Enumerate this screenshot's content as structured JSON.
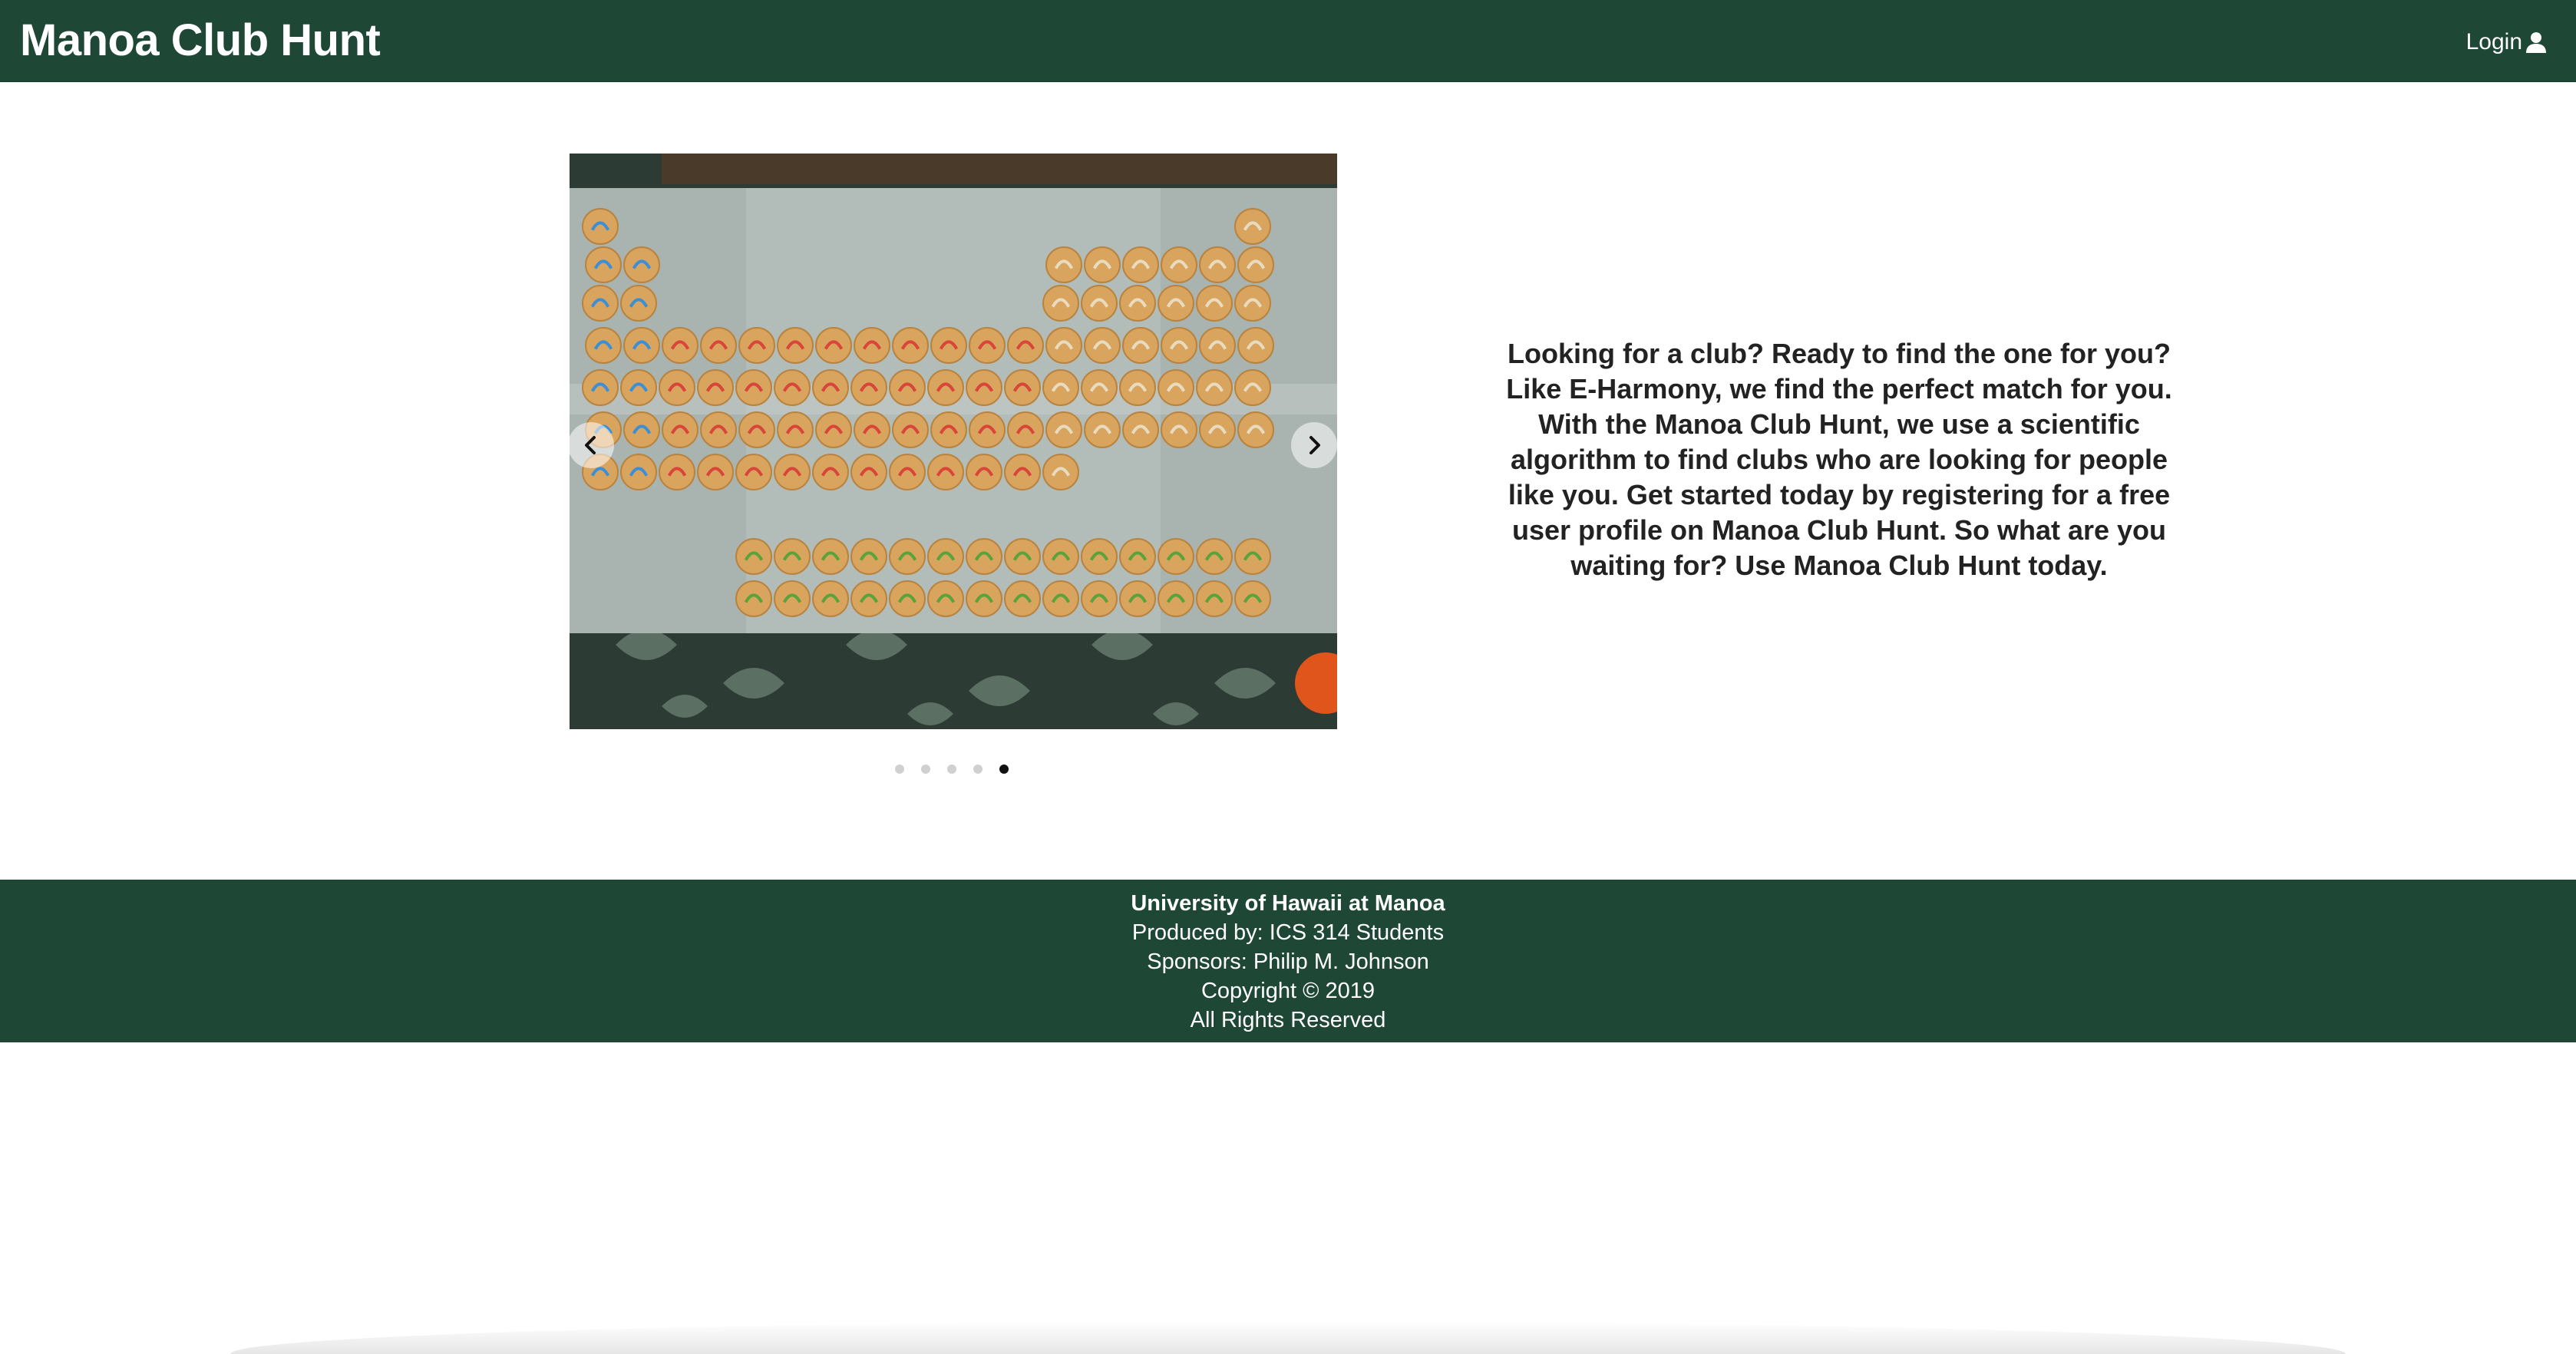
{
  "app": {
    "title": "Manoa Club Hunt"
  },
  "navbar": {
    "login_label": "Login",
    "login_icon": "user-icon"
  },
  "carousel": {
    "slide_count": 5,
    "active_index": 4,
    "prev_icon": "chevron-left-icon",
    "next_icon": "chevron-right-icon",
    "current_slide_description": "periodic table cookies"
  },
  "main": {
    "pitch": "Looking for a club? Ready to find the one for you? Like E-Harmony, we find the perfect match for you. With the Manoa Club Hunt, we use a scientific algorithm to find clubs who are looking for people like you. Get started today by registering for a free user profile on Manoa Club Hunt. So what are you waiting for? Use Manoa Club Hunt today."
  },
  "footer": {
    "line1": "University of Hawaii at Manoa",
    "line2": "Produced by: ICS 314 Students",
    "line3": "Sponsors: Philip M. Johnson",
    "line4": "Copyright © 2019",
    "line5": "All Rights Reserved"
  },
  "colors": {
    "brand_green": "#1e4735",
    "text_dark": "#222222",
    "dot_active": "#111111",
    "dot_inactive": "#d0d0d0"
  }
}
